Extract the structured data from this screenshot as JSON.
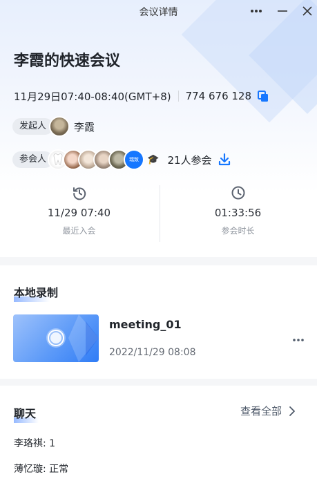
{
  "window": {
    "title": "会议详情"
  },
  "meeting": {
    "title": "李霞的快速会议",
    "time": "11月29日07:40-08:40(GMT+8)",
    "id": "774 676 128"
  },
  "host": {
    "label": "发起人",
    "name": "李霞"
  },
  "participants": {
    "label": "参会人",
    "badge_text": "瑞致",
    "extra_icon": "🎓",
    "count_text": "21人参会"
  },
  "stats": {
    "recent_join": {
      "value": "11/29 07:40",
      "label": "最近入会"
    },
    "duration": {
      "value": "01:33:56",
      "label": "参会时长"
    }
  },
  "recording": {
    "section_title": "本地录制",
    "item": {
      "name": "meeting_01",
      "date": "2022/11/29 08:08"
    }
  },
  "chat": {
    "section_title": "聊天",
    "view_all": "查看全部",
    "messages": [
      {
        "text": "李珞祺: 1"
      },
      {
        "text": "薄忆璇: 正常"
      }
    ]
  },
  "colors": {
    "accent": "#1677ff",
    "text": "#1f2329",
    "muted": "#8f959e"
  },
  "icons": {
    "copy": "copy-icon",
    "download": "download-icon",
    "history": "history-icon",
    "clock": "clock-icon",
    "more": "more-icon",
    "minimize": "minimize-icon",
    "close": "close-icon",
    "chevron": "chevron-right-icon"
  }
}
